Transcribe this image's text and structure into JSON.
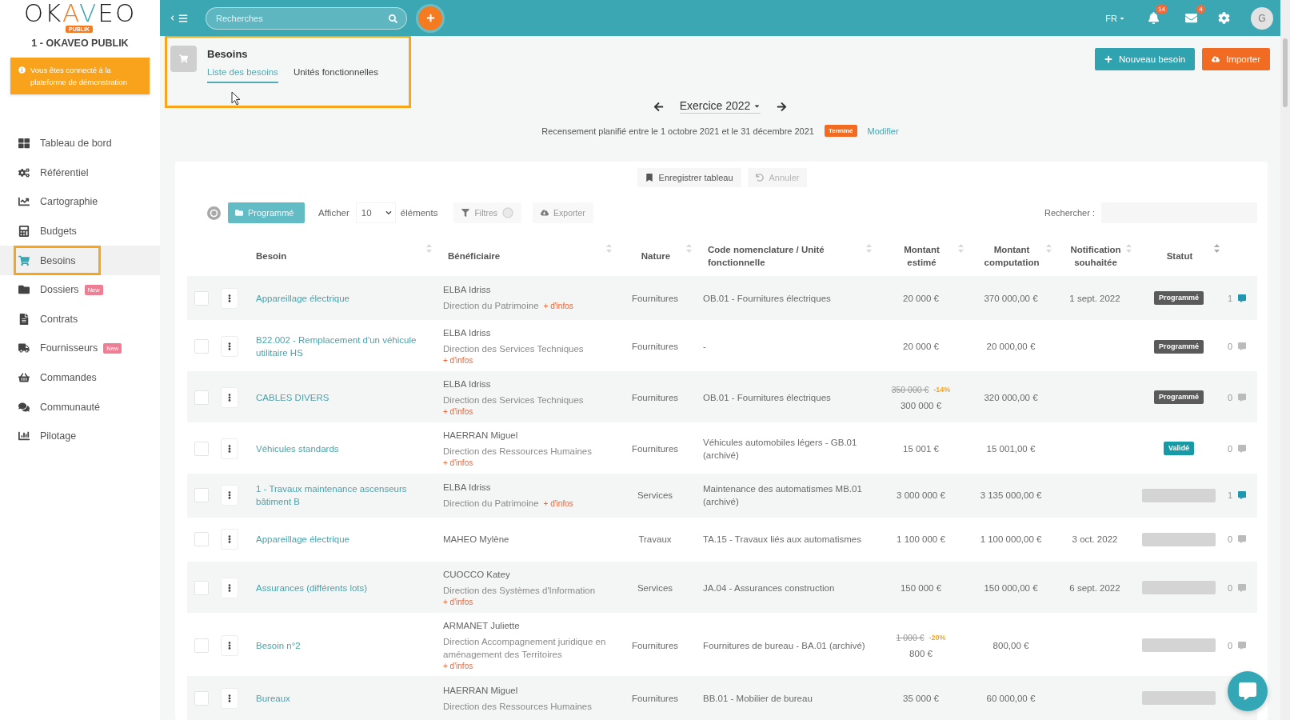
{
  "topbar": {
    "search": {
      "placeholder": "Recherches"
    },
    "language": "FR",
    "notifications": [
      {
        "count": "14"
      },
      {
        "count": "4"
      }
    ],
    "avatar": "G"
  },
  "sidebar": {
    "logo": {
      "text": "OKAVEO",
      "badge": "PUBLIK"
    },
    "organization": "1 - OKAVEO PUBLIK",
    "banner": "Vous êtes connecté à la plateforme de démonstration",
    "items": [
      {
        "label": "Tableau de bord",
        "selected": false,
        "highlighted": false
      },
      {
        "label": "Référentiel",
        "selected": false,
        "highlighted": false
      },
      {
        "label": "Cartographie",
        "selected": false,
        "highlighted": false
      },
      {
        "label": "Budgets",
        "selected": false,
        "highlighted": false
      },
      {
        "label": "Besoins",
        "selected": true,
        "highlighted": true
      },
      {
        "label": "Dossiers",
        "badge": "New",
        "selected": false,
        "highlighted": false
      },
      {
        "label": "Contrats",
        "selected": false,
        "highlighted": false
      },
      {
        "label": "Fournisseurs",
        "badge": "New",
        "selected": false,
        "highlighted": false
      },
      {
        "label": "Commandes",
        "selected": false,
        "highlighted": false
      },
      {
        "label": "Communauté",
        "selected": false,
        "highlighted": false
      },
      {
        "label": "Pilotage",
        "selected": false,
        "highlighted": false
      }
    ]
  },
  "page_header": {
    "title": "Besoins",
    "highlighted": true,
    "tabs": [
      {
        "label": "Liste des besoins",
        "selected": true
      },
      {
        "label": "Unités fonctionnelles",
        "selected": false
      }
    ],
    "actions": [
      {
        "label": "Nouveau besoin",
        "kind": "primary"
      },
      {
        "label": "Importer",
        "kind": "warning"
      }
    ]
  },
  "exercise": {
    "label": "Exercice 2022"
  },
  "census": {
    "text": "Recensement planifié entre le 1 octobre 2021 et le 31 décembre 2021",
    "status": "Terminé",
    "action": "Modifier"
  },
  "table_actions": [
    {
      "label": "Enregistrer tableau",
      "disabled": false
    },
    {
      "label": "Annuler",
      "disabled": true
    }
  ],
  "toolbar": {
    "filter_button": "Programmé",
    "show_label": "Afficher",
    "page_size": "10",
    "page_size_suffix": "éléments",
    "filters": "Filtres",
    "export": "Exporter",
    "search_label": "Rechercher :"
  },
  "table": {
    "columns": [
      {
        "label": "Besoin"
      },
      {
        "label": "Bénéficiaire"
      },
      {
        "label": "Nature"
      },
      {
        "label": "Code nomenclature / Unité fonctionnelle"
      },
      {
        "label": "Montant estimé"
      },
      {
        "label": "Montant computation"
      },
      {
        "label": "Notification souhaitée"
      },
      {
        "label": "Statut"
      }
    ],
    "rows": [
      {
        "checked": false,
        "name": "Appareillage électrique",
        "beneficiary": {
          "name": "ELBA Idriss",
          "department": "Direction du Patrimoine",
          "more_info": "+ d'infos"
        },
        "nature": "Fournitures",
        "code": "OB.01 - Fournitures électriques",
        "estimate": {
          "value": "20 000 €"
        },
        "computation": "370 000,00 €",
        "notification": "1 sept. 2022",
        "status": {
          "kind": "dark",
          "label": "Programmé"
        },
        "comments": {
          "count": "1",
          "unread": true
        }
      },
      {
        "checked": false,
        "name": "B22.002 - Remplacement d'un véhicule utilitaire HS",
        "beneficiary": {
          "name": "ELBA Idriss",
          "department": "Direction des Services Techniques",
          "more_info": "+ d'infos"
        },
        "nature": "Fournitures",
        "code": "-",
        "estimate": {
          "value": "20 000 €"
        },
        "computation": "20 000,00 €",
        "status": {
          "kind": "dark",
          "label": "Programmé"
        },
        "comments": {
          "count": "0",
          "unread": false
        }
      },
      {
        "checked": false,
        "name": "CABLES DIVERS",
        "beneficiary": {
          "name": "ELBA Idriss",
          "department": "Direction des Services Techniques",
          "more_info": "+ d'infos"
        },
        "nature": "Fournitures",
        "code": "OB.01 - Fournitures électriques",
        "estimate": {
          "original": "350 000 €",
          "discount": "-14%",
          "value": "300 000 €"
        },
        "computation": "320 000,00 €",
        "status": {
          "kind": "dark",
          "label": "Programmé"
        },
        "comments": {
          "count": "0",
          "unread": false
        }
      },
      {
        "checked": false,
        "name": "Véhicules standards",
        "beneficiary": {
          "name": "HAERRAN Miguel",
          "department": "Direction des Ressources Humaines",
          "more_info": "+ d'infos"
        },
        "nature": "Fournitures",
        "code": "Véhicules automobiles légers - GB.01 (archivé)",
        "estimate": {
          "value": "15 001 €"
        },
        "computation": "15 001,00 €",
        "status": {
          "kind": "teal",
          "label": "Validé"
        },
        "comments": {
          "count": "0",
          "unread": false
        }
      },
      {
        "checked": false,
        "name": "1 - Travaux maintenance ascenseurs bâtiment B",
        "beneficiary": {
          "name": "ELBA Idriss",
          "department": "Direction du Patrimoine",
          "more_info": "+ d'infos"
        },
        "nature": "Services",
        "code": "Maintenance des automatismes MB.01 (archivé)",
        "estimate": {
          "value": "3 000 000 €"
        },
        "computation": "3 135 000,00 €",
        "status": {
          "kind": "muted"
        },
        "comments": {
          "count": "1",
          "unread": true
        }
      },
      {
        "checked": false,
        "name": "Appareillage électrique",
        "beneficiary": {
          "name": "MAHEO Mylène"
        },
        "nature": "Travaux",
        "code": "TA.15 - Travaux liés aux automatismes",
        "estimate": {
          "value": "1 100 000 €"
        },
        "computation": "1 100 000,00 €",
        "notification": "3 oct. 2022",
        "status": {
          "kind": "muted"
        },
        "comments": {
          "count": "0",
          "unread": false
        }
      },
      {
        "checked": false,
        "name": "Assurances (différents lots)",
        "beneficiary": {
          "name": "CUOCCO Katey",
          "department": "Direction des Systèmes d'Information",
          "more_info": "+ d'infos"
        },
        "nature": "Services",
        "code": "JA.04 - Assurances construction",
        "estimate": {
          "value": "150 000 €"
        },
        "computation": "150 000,00 €",
        "notification": "6 sept. 2022",
        "status": {
          "kind": "muted"
        },
        "comments": {
          "count": "0",
          "unread": false
        }
      },
      {
        "checked": false,
        "name": "Besoin n°2",
        "beneficiary": {
          "name": "ARMANET Juliette",
          "department": "Direction Accompagnement juridique en aménagement des Territoires",
          "more_info": "+ d'infos"
        },
        "nature": "Fournitures",
        "code": "Fournitures de bureau - BA.01 (archivé)",
        "estimate": {
          "original": "1 000 €",
          "discount": "-20%",
          "value": "800 €"
        },
        "computation": "800,00 €",
        "status": {
          "kind": "muted"
        },
        "comments": {
          "count": "0",
          "unread": false
        }
      },
      {
        "checked": false,
        "name": "Bureaux",
        "beneficiary": {
          "name": "HAERRAN Miguel",
          "department": "Direction des Ressources Humaines"
        },
        "nature": "Fournitures",
        "code": "BB.01 - Mobilier de bureau",
        "estimate": {
          "value": "35 000 €"
        },
        "computation": "60 000,00 €",
        "status": {
          "kind": "muted"
        }
      }
    ]
  }
}
